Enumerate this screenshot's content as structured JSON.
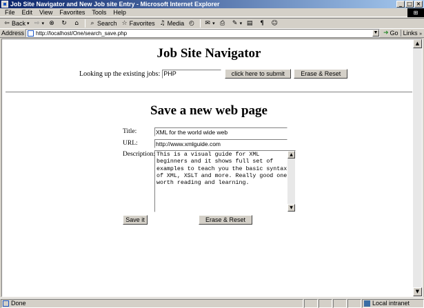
{
  "window": {
    "title": "Job Site Navigator and New Job site Entry - Microsoft Internet Explorer",
    "minimize": "_",
    "maximize": "□",
    "close": "×"
  },
  "menu": [
    "File",
    "Edit",
    "View",
    "Favorites",
    "Tools",
    "Help"
  ],
  "toolbar": {
    "back": "Back",
    "search": "Search",
    "favorites": "Favorites",
    "media": "Media"
  },
  "address": {
    "label": "Address",
    "url": "http://localhost/One/search_save.php",
    "go": "Go",
    "links": "Links"
  },
  "page": {
    "nav_title": "Job Site Navigator",
    "lookup_label": "Looking up the existing jobs:",
    "lookup_value": "PHP",
    "submit_label": "click here to submit",
    "reset_label": "Erase & Reset",
    "save_title": "Save a new web page",
    "title_label": "Title:",
    "title_value": "XML for the world wide web",
    "url_label": "URL:",
    "url_value": "http://www.xmlguide.com",
    "description_label": "Description:",
    "description_value": "This is a visual guide for XML\nbeginners and it shows full set of\nexamples to teach you the basic syntax\nof XML, XSLT and more. Really good one,\nworth reading and learning.",
    "save_label": "Save it",
    "erase_label": "Erase & Reset"
  },
  "status": {
    "text": "Done",
    "zone": "Local intranet"
  }
}
